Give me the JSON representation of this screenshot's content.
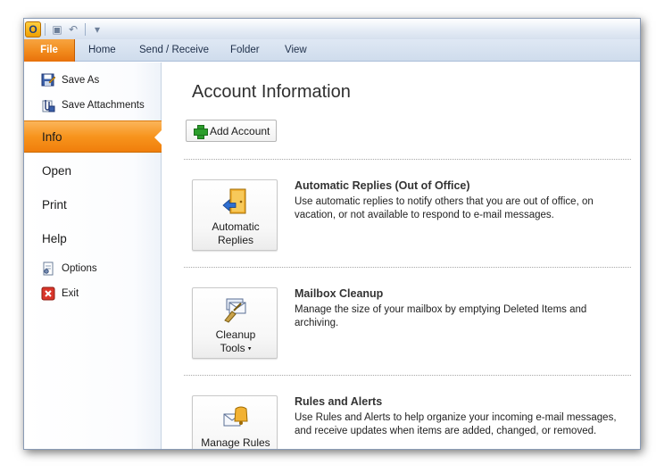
{
  "app": {
    "logo_letter": "O"
  },
  "qat": {
    "save_glyph": "▣",
    "undo_glyph": "↶",
    "customize_glyph": "▾"
  },
  "tabs": [
    {
      "label": "File"
    },
    {
      "label": "Home"
    },
    {
      "label": "Send / Receive"
    },
    {
      "label": "Folder"
    },
    {
      "label": "View"
    }
  ],
  "nav": {
    "save_as": "Save As",
    "save_attachments": "Save Attachments",
    "info": "Info",
    "open": "Open",
    "print": "Print",
    "help": "Help",
    "options": "Options",
    "exit": "Exit"
  },
  "content": {
    "title": "Account Information",
    "add_account": "Add Account",
    "sections": [
      {
        "tile_line1": "Automatic",
        "tile_line2": "Replies",
        "title": "Automatic Replies (Out of Office)",
        "description": "Use automatic replies to notify others that you are out of office, on vacation, or not available to respond to e-mail messages."
      },
      {
        "tile_line1": "Cleanup",
        "tile_line2": "Tools",
        "dropdown_glyph": "▾",
        "title": "Mailbox Cleanup",
        "description": "Manage the size of your mailbox by emptying Deleted Items and archiving."
      },
      {
        "tile_line1": "Manage Rules",
        "title": "Rules and Alerts",
        "description": "Use Rules and Alerts to help organize your incoming e-mail messages, and receive updates when items are added, changed, or removed."
      }
    ]
  },
  "colors": {
    "file_tab": "#f18a1c",
    "active_nav": "#f7941d",
    "ribbon": "#d6e0ee"
  }
}
